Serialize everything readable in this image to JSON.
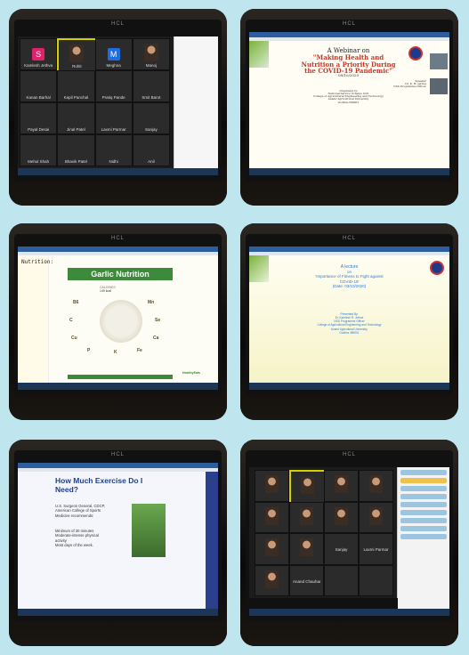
{
  "photos": [
    {
      "id": "zoom-grid-1",
      "monitor_brand": "HCL",
      "tiles": [
        {
          "initial": "S",
          "color": "#e0226c",
          "name": "Kamlesh Jethva"
        },
        {
          "initial": "",
          "color": "",
          "name": "Rohit"
        },
        {
          "initial": "M",
          "color": "#1f6de0",
          "name": "Meghna"
        },
        {
          "initial": "",
          "color": "",
          "name": "Manoj"
        },
        {
          "initial": "",
          "color": "",
          "name": "Kanan Barhal"
        },
        {
          "initial": "",
          "color": "",
          "name": "Kapil Panchal"
        },
        {
          "initial": "",
          "color": "",
          "name": "Pratiq Pande"
        },
        {
          "initial": "",
          "color": "",
          "name": "Smit Barot"
        },
        {
          "initial": "",
          "color": "",
          "name": "Payal Desai"
        },
        {
          "initial": "",
          "color": "",
          "name": "Jinal Patel"
        },
        {
          "initial": "",
          "color": "",
          "name": "Laxmi Parmar"
        },
        {
          "initial": "",
          "color": "",
          "name": "Sanjay"
        },
        {
          "initial": "",
          "color": "",
          "name": "Mehul Shah"
        },
        {
          "initial": "",
          "color": "",
          "name": "Bhavik Patel"
        },
        {
          "initial": "",
          "color": "",
          "name": "Nidhi"
        },
        {
          "initial": "",
          "color": "",
          "name": "Anil"
        }
      ]
    },
    {
      "id": "webinar-slide",
      "monitor_brand": "HCL",
      "lines": [
        "A Webinar on",
        "\"Making Health and",
        "Nutrition a Priority During",
        "the COVID-19 Pandemic\"",
        "08/10/2020"
      ],
      "speaker_label": "Speaker",
      "speaker": "Dr. K. H. Jethva",
      "speaker_role": "NSS Programme Officer",
      "organizer_label": "Organized by",
      "organizer": "National Service Scheme Unit",
      "college": "College of Agricultural Engineering and Technology",
      "university": "Anand Agricultural University",
      "city": "Godhra-389001"
    },
    {
      "id": "nutrition-slide",
      "monitor_brand": "HCL",
      "heading": "Nutrition:",
      "banner": "Garlic Nutrition",
      "calories_label": "CALORIES",
      "calories_value": "149 kcal",
      "minerals": [
        "B6",
        "Mn",
        "C",
        "Se",
        "Cu",
        "Ca",
        "P",
        "K",
        "Fe"
      ],
      "footer": "HealthyEats"
    },
    {
      "id": "lecture-slide",
      "monitor_brand": "HCL",
      "lines": [
        "A lecture",
        "on",
        "'Importance of Fitness to Fight against",
        "COVID-19'",
        "(Date: 03/10/2020)"
      ],
      "presenter_label": "Presented By:",
      "presenter": "Er. Kamlesh R. Jethva",
      "presenter_role": "NSS Programme Officer",
      "college": "College of Agricultural Engineering and Technology",
      "university": "Anand Agricultural University,",
      "city": "Godhra 389001"
    },
    {
      "id": "exercise-slide",
      "monitor_brand": "HCL",
      "title_line1": "How Much Exercise Do I",
      "title_line2": "Need?",
      "sub1": "U.S. Surgeon General, CDCP,",
      "sub2": "American College of Sports",
      "sub3": "Medicine recommends:",
      "b1": "Minimum of 30 minutes",
      "b2": "Moderate-intense physical",
      "b3": "activity",
      "b4": "Most days of the week."
    },
    {
      "id": "zoom-grid-2",
      "monitor_brand": "HCL",
      "names": [
        "Sanjay",
        "Laxmi Parmar",
        "Anand Chauhan"
      ]
    }
  ]
}
